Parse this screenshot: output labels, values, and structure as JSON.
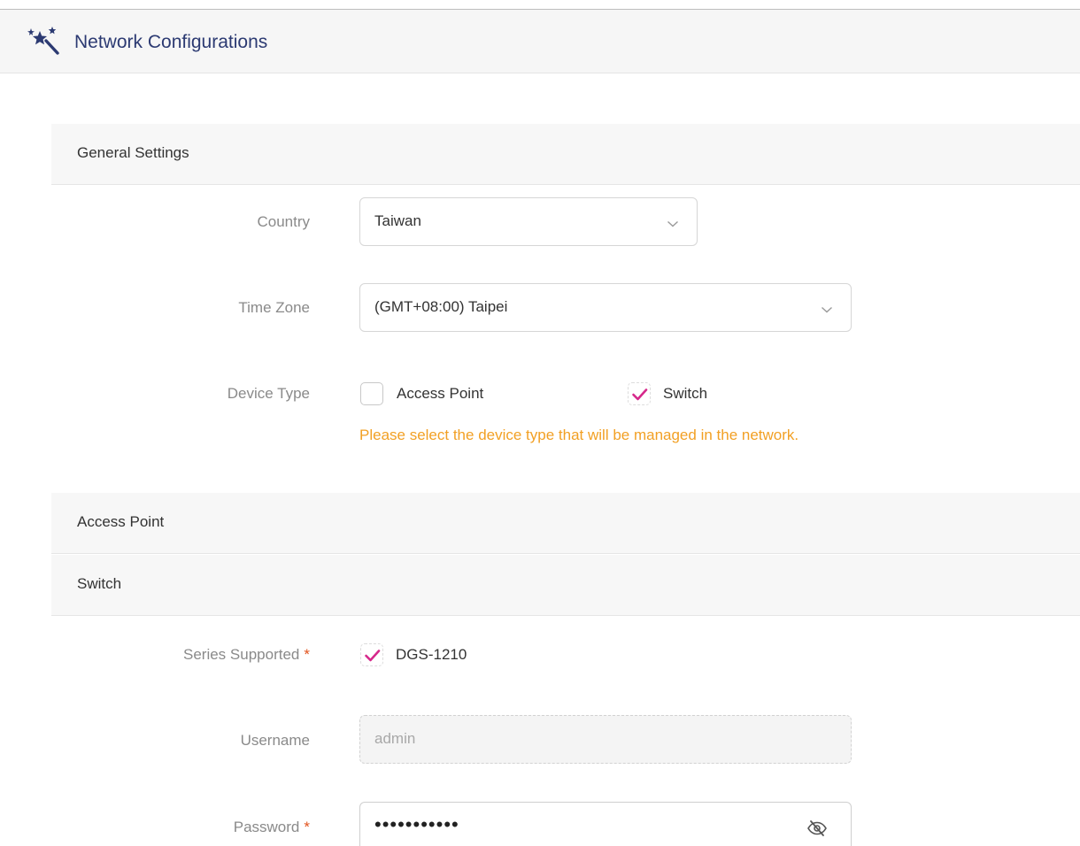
{
  "header": {
    "title": "Network Configurations",
    "icon": "magic-wand-icon"
  },
  "sections": {
    "general": "General Settings",
    "access_point": "Access Point",
    "switch": "Switch"
  },
  "form": {
    "country": {
      "label": "Country",
      "value": "Taiwan"
    },
    "time_zone": {
      "label": "Time Zone",
      "value": "(GMT+08:00) Taipei"
    },
    "device_type": {
      "label": "Device Type",
      "options": [
        {
          "label": "Access Point",
          "checked": false
        },
        {
          "label": "Switch",
          "checked": true
        }
      ],
      "hint": "Please select the device type that will be managed in the network."
    },
    "series_supported": {
      "label": "Series Supported",
      "required": "*",
      "option": {
        "label": "DGS-1210",
        "checked": true
      }
    },
    "username": {
      "label": "Username",
      "value": "admin"
    },
    "password": {
      "label": "Password",
      "required": "*",
      "masked": "•••••••••••"
    }
  },
  "colors": {
    "title": "#2c3a72",
    "check": "#d6288b",
    "hint": "#f2a024",
    "required": "#e2541e"
  }
}
